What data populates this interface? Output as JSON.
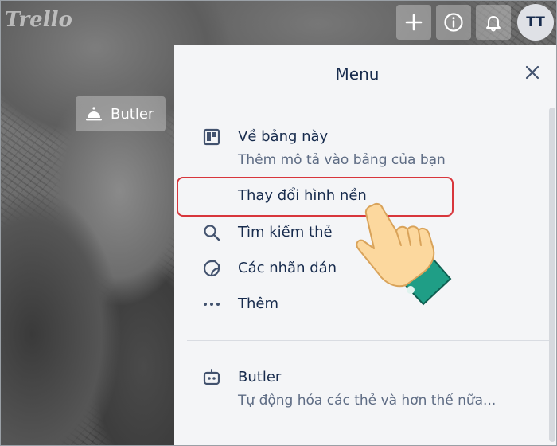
{
  "header": {
    "logo_text": "Trello",
    "add_icon": "plus-icon",
    "info_icon": "info-icon",
    "notifications_icon": "bell-icon",
    "avatar_initials": "TT"
  },
  "board": {
    "butler_label": "Butler",
    "butler_icon": "service-bell-icon"
  },
  "menu": {
    "title": "Menu",
    "close_icon": "close-icon",
    "about": {
      "label": "Về bảng này",
      "subtitle": "Thêm mô tả vào bảng của bạn",
      "icon": "board-icon"
    },
    "change_background": {
      "label": "Thay đổi hình nền"
    },
    "search_cards": {
      "label": "Tìm kiếm thẻ",
      "icon": "search-icon"
    },
    "stickers": {
      "label": "Các nhãn dán",
      "icon": "sticker-icon"
    },
    "more": {
      "label": "Thêm",
      "icon": "ellipsis-icon"
    },
    "butler": {
      "label": "Butler",
      "subtitle": "Tự động hóa các thẻ và hơn thế nữa...",
      "icon": "robot-icon"
    }
  },
  "annotation": {
    "highlight_color": "#d8363c",
    "pointer": "pointing-hand-icon"
  }
}
